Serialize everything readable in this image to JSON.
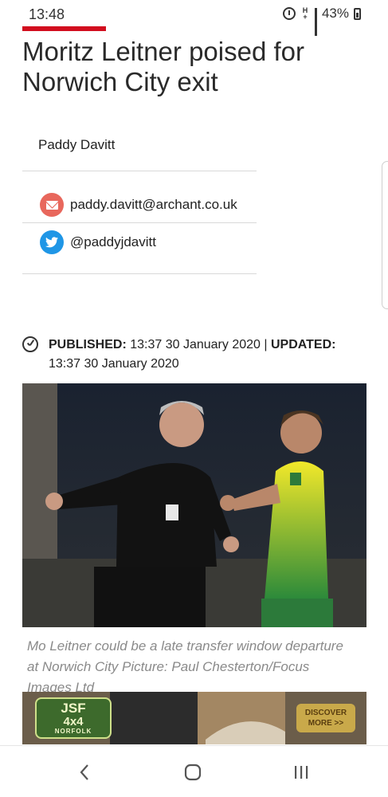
{
  "status_bar": {
    "time": "13:48",
    "battery": "43%",
    "icons": [
      "alarm-icon",
      "network-type-icon",
      "signal-icon",
      "battery-icon"
    ]
  },
  "article": {
    "headline": "Moritz Leitner poised for Norwich City exit",
    "author": {
      "name": "Paddy Davitt",
      "email": "paddy.davitt@archant.co.uk",
      "twitter": "@paddyjdavitt"
    },
    "published_label": "PUBLISHED:",
    "published_value": "13:37 30 January 2020",
    "separator": "|",
    "updated_label": "UPDATED:",
    "updated_value": "13:37 30 January 2020",
    "photo_caption": "Mo Leitner could be a late transfer window departure at Norwich City Picture: Paul Chesterton/Focus Images Ltd"
  },
  "advert": {
    "logo_line1": "JSF",
    "logo_line2": "4x4",
    "logo_line3": "NORFOLK",
    "button_line1": "DISCOVER",
    "button_line2": "MORE >>"
  },
  "colors": {
    "accent": "#d20e1e",
    "email": "#e8675c",
    "twitter": "#1f96e6"
  },
  "nav": {
    "icons": [
      "back-icon",
      "home-icon",
      "recent-apps-icon"
    ]
  }
}
